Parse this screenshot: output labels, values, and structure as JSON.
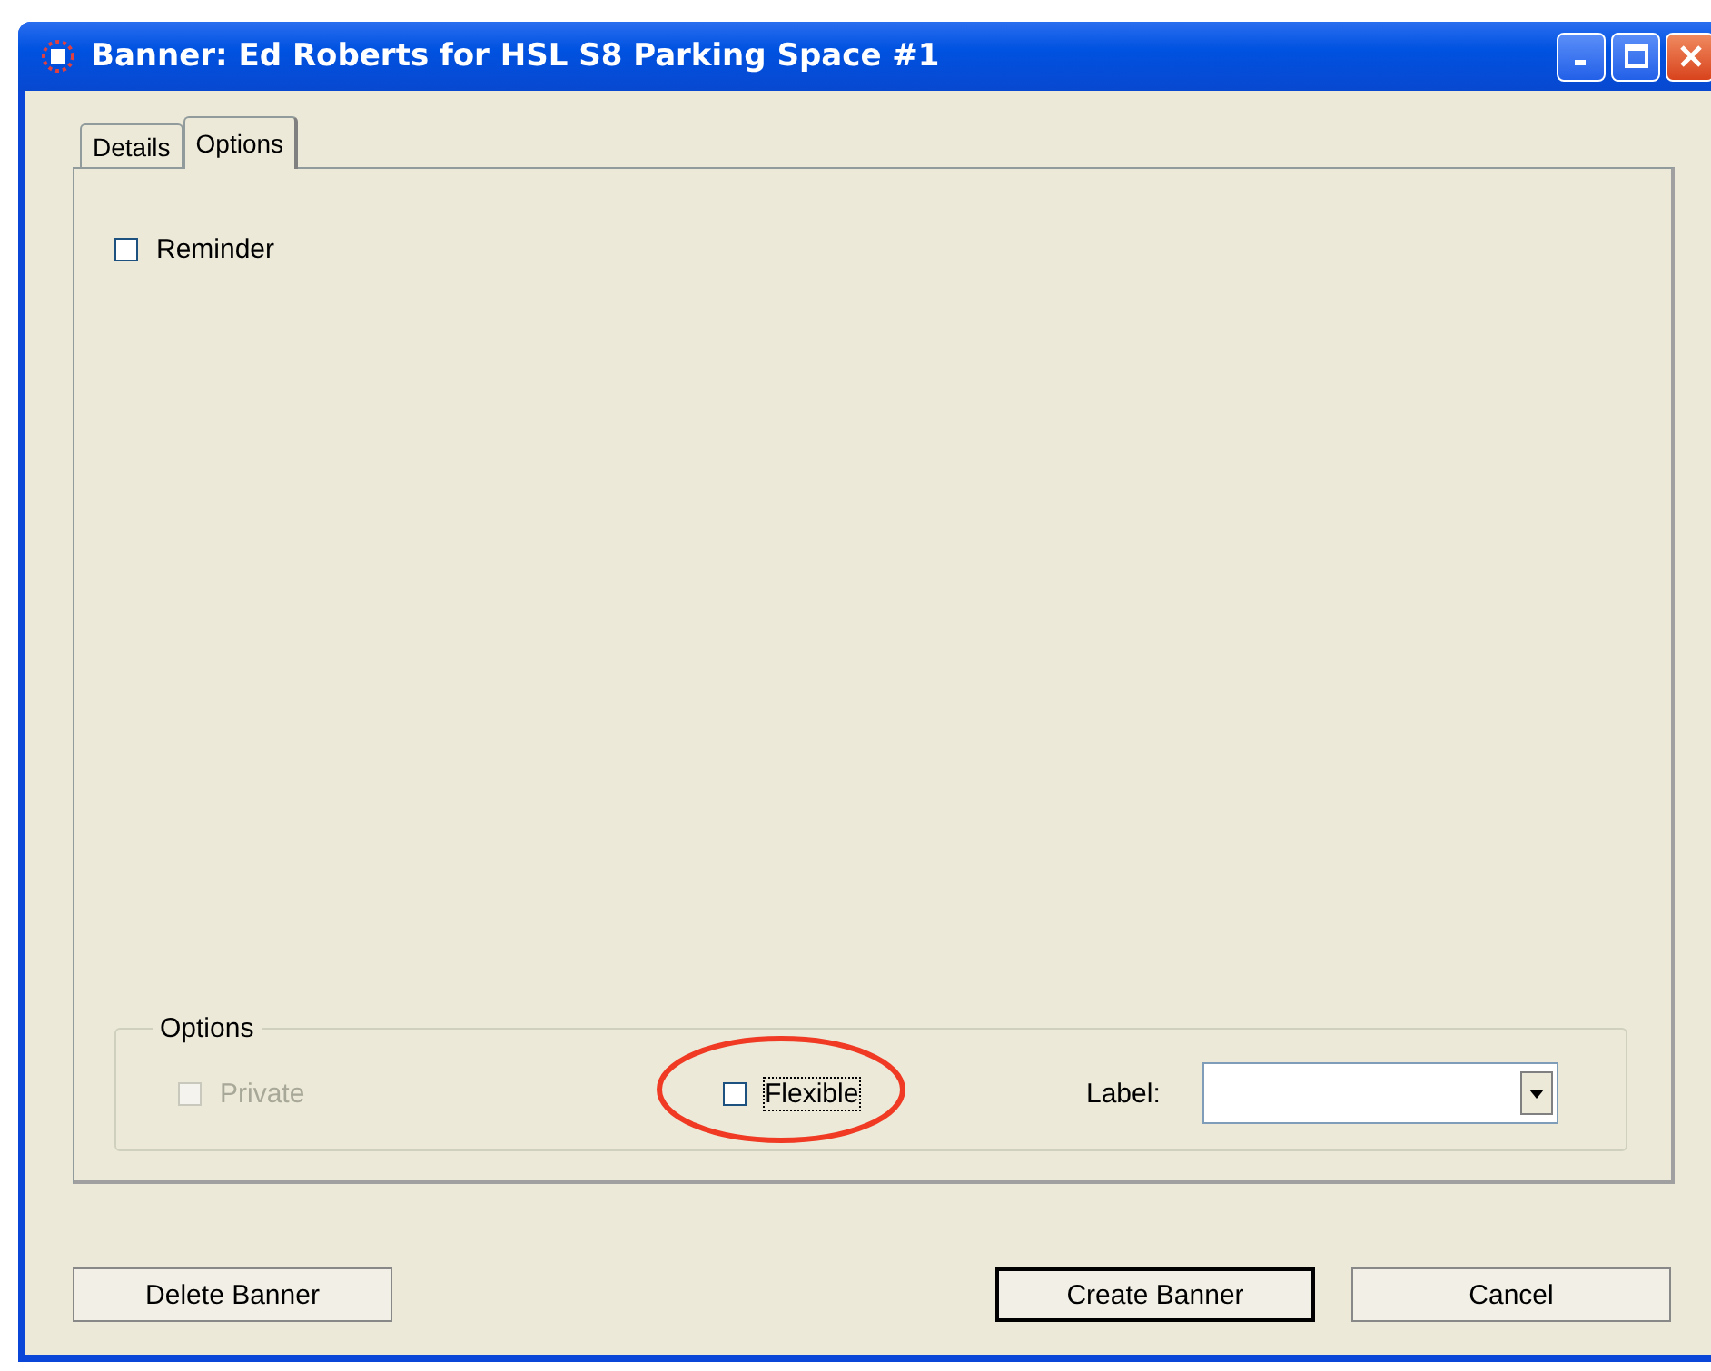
{
  "window": {
    "title": "Banner: Ed Roberts for HSL S8 Parking Space #1"
  },
  "tabs": [
    {
      "label": "Details",
      "selected": false
    },
    {
      "label": "Options",
      "selected": true
    }
  ],
  "reminder": {
    "label": "Reminder",
    "checked": false
  },
  "options_group": {
    "title": "Options",
    "checkboxes": [
      {
        "label": "Private",
        "checked": false,
        "disabled": true,
        "circled": false
      },
      {
        "label": "Flexible",
        "checked": false,
        "disabled": false,
        "circled": true
      }
    ],
    "label_field": {
      "label": "Label:"
    }
  },
  "buttons": [
    {
      "label": "Delete Banner",
      "default": false
    },
    {
      "label": "Create Banner",
      "default": true
    },
    {
      "label": "Cancel",
      "default": false
    }
  ]
}
